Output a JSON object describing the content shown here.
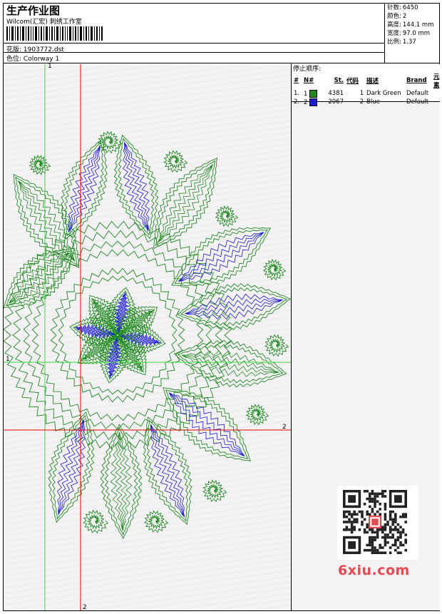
{
  "header": {
    "title": "生产作业图",
    "company": "Wilcom(汇宏) 刺绣工作室",
    "design_label": "花版:",
    "design_value": "1903772.dst",
    "colorway_label": "色位:",
    "colorway_value": "Colorway 1"
  },
  "stats": {
    "stitches_label": "针数:",
    "stitches_value": "6450",
    "colors_label": "颜色:",
    "colors_value": "2",
    "height_label": "高度:",
    "height_value": "144.1 mm",
    "width_label": "宽度:",
    "width_value": "97.0 mm",
    "scale_label": "比例:",
    "scale_value": "1.37"
  },
  "stop_sequence": {
    "title": "停止顺序:",
    "headers": [
      "#",
      "N#",
      "St.",
      "代码",
      "描述",
      "Brand",
      "元素"
    ],
    "rows": [
      {
        "index": "1.",
        "n": "1",
        "color": "#1f8a1f",
        "st": "4381",
        "code": "1",
        "desc": "Dark Green",
        "brand": "Default",
        "element": ""
      },
      {
        "index": "2.",
        "n": "2",
        "color": "#1a1ad8",
        "st": "2067",
        "code": "2",
        "desc": "Blue",
        "brand": "Default",
        "element": ""
      }
    ]
  },
  "axes": {
    "green_v_top": "1",
    "green_h_left": "1",
    "red_h_right": "2",
    "red_v_bottom": "2"
  },
  "colors": {
    "green_thread": "#1f8a1f",
    "blue_thread": "#1a1ad8",
    "green_axis": "#33dd33",
    "red_axis": "#e00000",
    "canvas_bg": "#f4f2f5"
  },
  "watermark": "6xiu.com"
}
